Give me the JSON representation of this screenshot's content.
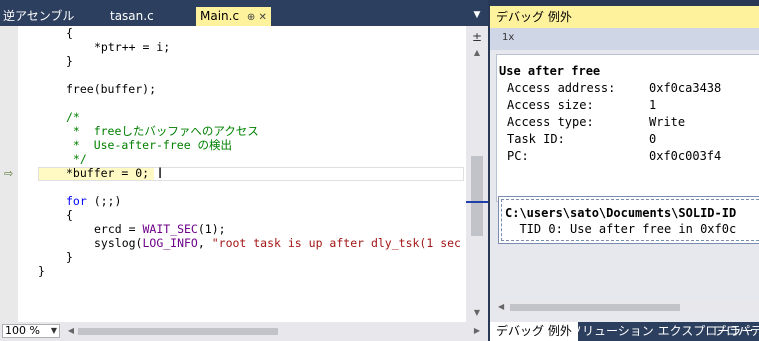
{
  "editor_tabs": [
    {
      "label": "逆アセンブル"
    },
    {
      "label": "tasan.c"
    },
    {
      "label": "Main.c",
      "active": true
    }
  ],
  "editor_tab_icons": {
    "pin": "⊕",
    "close": "✕"
  },
  "code_lines": [
    {
      "row": 0,
      "indent": 4,
      "segments": [
        {
          "t": "{",
          "c": ""
        }
      ]
    },
    {
      "row": 1,
      "indent": 8,
      "segments": [
        {
          "t": "*ptr++ = i;",
          "c": ""
        }
      ]
    },
    {
      "row": 2,
      "indent": 4,
      "segments": [
        {
          "t": "}",
          "c": ""
        }
      ]
    },
    {
      "row": 4,
      "indent": 4,
      "segments": [
        {
          "t": "free(buffer);",
          "c": ""
        }
      ]
    },
    {
      "row": 6,
      "indent": 4,
      "segments": [
        {
          "t": "/*",
          "c": "cm"
        }
      ]
    },
    {
      "row": 7,
      "indent": 4,
      "segments": [
        {
          "t": " *  freeしたバッファへのアクセス",
          "c": "cm"
        }
      ]
    },
    {
      "row": 8,
      "indent": 4,
      "segments": [
        {
          "t": " *  Use-after-free の検出",
          "c": "cm"
        }
      ]
    },
    {
      "row": 9,
      "indent": 4,
      "segments": [
        {
          "t": " */",
          "c": "cm"
        }
      ]
    },
    {
      "row": 10,
      "indent": 4,
      "segments": [
        {
          "t": "*buffer = 0;",
          "c": ""
        }
      ]
    },
    {
      "row": 12,
      "indent": 4,
      "segments": [
        {
          "t": "for",
          "c": "kw"
        },
        {
          "t": " (;;)",
          "c": ""
        }
      ]
    },
    {
      "row": 13,
      "indent": 4,
      "segments": [
        {
          "t": "{",
          "c": ""
        }
      ]
    },
    {
      "row": 14,
      "indent": 8,
      "segments": [
        {
          "t": "ercd = ",
          "c": ""
        },
        {
          "t": "WAIT_SEC",
          "c": "mac"
        },
        {
          "t": "(1);",
          "c": ""
        }
      ]
    },
    {
      "row": 15,
      "indent": 8,
      "segments": [
        {
          "t": "syslog(",
          "c": ""
        },
        {
          "t": "LOG_INFO",
          "c": "mac"
        },
        {
          "t": ", ",
          "c": ""
        },
        {
          "t": "\"root task is up after dly_tsk(1 sec",
          "c": "str"
        }
      ]
    },
    {
      "row": 16,
      "indent": 4,
      "segments": [
        {
          "t": "}",
          "c": ""
        }
      ]
    },
    {
      "row": 17,
      "indent": 0,
      "segments": [
        {
          "t": "}",
          "c": ""
        }
      ]
    }
  ],
  "zoom": {
    "value": "100 %"
  },
  "debug_panel": {
    "title": "デバッグ 例外",
    "toolbar_label": "1x",
    "heading": "Use after free",
    "fields": [
      {
        "label": "Access address:",
        "value": "0xf0ca3438"
      },
      {
        "label": "Access size:",
        "value": "1"
      },
      {
        "label": "Access type:",
        "value": "Write"
      },
      {
        "label": "Task ID:",
        "value": "0"
      },
      {
        "label": "PC:",
        "value": "0xf0c003f4"
      }
    ],
    "location": {
      "path": "C:\\users\\sato\\Documents\\SOLID-ID",
      "detail": "  TID 0: Use after free in 0xf0c"
    }
  },
  "tool_tabs": [
    {
      "label": "デバッグ 例外",
      "active": true
    },
    {
      "label": "ソリューション エクスプローラー"
    },
    {
      "label": "プロパティ"
    }
  ],
  "colors": {
    "chrome": "#2d3f5e",
    "active_tab": "#fff29d",
    "comment": "#008000",
    "keyword": "#0000ff",
    "macro": "#6f008a",
    "string": "#a31515"
  }
}
